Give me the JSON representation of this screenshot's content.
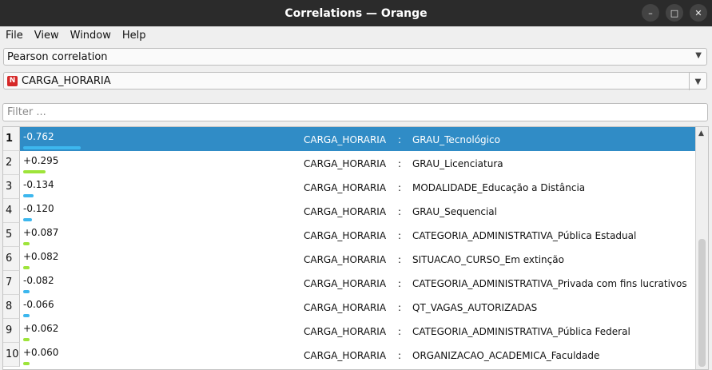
{
  "window": {
    "title": "Correlations — Orange"
  },
  "menu": [
    "File",
    "View",
    "Window",
    "Help"
  ],
  "correlation_type": {
    "selected": "Pearson correlation"
  },
  "feature": {
    "badge": "N",
    "selected": "CARGA_HORARIA"
  },
  "filter": {
    "placeholder": "Filter ...",
    "value": ""
  },
  "colors": {
    "negative": "#3db7ee",
    "positive": "#9ee43a",
    "selected": "#308cc6"
  },
  "rows": [
    {
      "n": "1",
      "value": "-0.762",
      "score": -0.762,
      "var1": "CARGA_HORARIA",
      "sep": ":",
      "var2": "GRAU_Tecnológico",
      "selected": true
    },
    {
      "n": "2",
      "value": "+0.295",
      "score": 0.295,
      "var1": "CARGA_HORARIA",
      "sep": ":",
      "var2": "GRAU_Licenciatura"
    },
    {
      "n": "3",
      "value": "-0.134",
      "score": -0.134,
      "var1": "CARGA_HORARIA",
      "sep": ":",
      "var2": "MODALIDADE_Educação a Distância"
    },
    {
      "n": "4",
      "value": "-0.120",
      "score": -0.12,
      "var1": "CARGA_HORARIA",
      "sep": ":",
      "var2": "GRAU_Sequencial"
    },
    {
      "n": "5",
      "value": "+0.087",
      "score": 0.087,
      "var1": "CARGA_HORARIA",
      "sep": ":",
      "var2": "CATEGORIA_ADMINISTRATIVA_Pública Estadual"
    },
    {
      "n": "6",
      "value": "+0.082",
      "score": 0.082,
      "var1": "CARGA_HORARIA",
      "sep": ":",
      "var2": "SITUACAO_CURSO_Em extinção"
    },
    {
      "n": "7",
      "value": "-0.082",
      "score": -0.082,
      "var1": "CARGA_HORARIA",
      "sep": ":",
      "var2": "CATEGORIA_ADMINISTRATIVA_Privada com fins lucrativos"
    },
    {
      "n": "8",
      "value": "-0.066",
      "score": -0.066,
      "var1": "CARGA_HORARIA",
      "sep": ":",
      "var2": "QT_VAGAS_AUTORIZADAS"
    },
    {
      "n": "9",
      "value": "+0.062",
      "score": 0.062,
      "var1": "CARGA_HORARIA",
      "sep": ":",
      "var2": "CATEGORIA_ADMINISTRATIVA_Pública Federal"
    },
    {
      "n": "10",
      "value": "+0.060",
      "score": 0.06,
      "var1": "CARGA_HORARIA",
      "sep": ":",
      "var2": "ORGANIZACAO_ACADEMICA_Faculdade"
    }
  ]
}
